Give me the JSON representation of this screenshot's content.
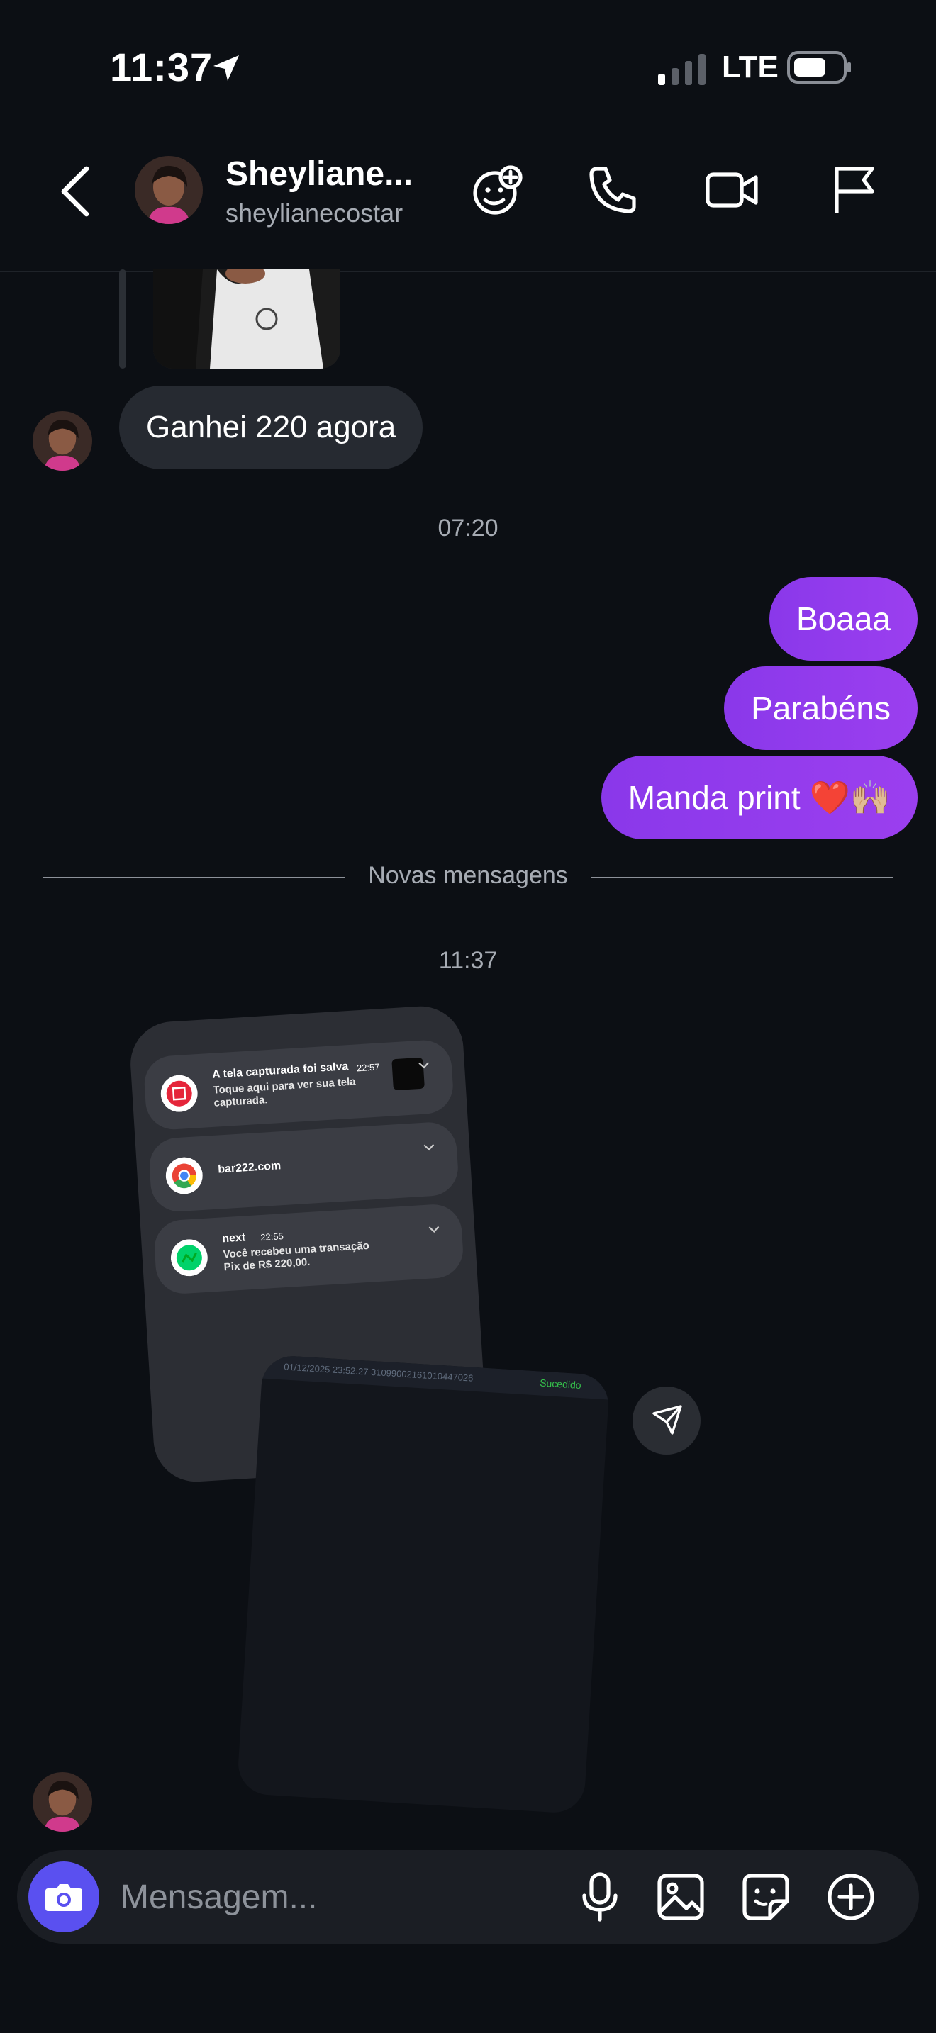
{
  "status_bar": {
    "time": "11:37",
    "network": "LTE"
  },
  "header": {
    "name": "Sheyliane...",
    "username": "sheylianecostar",
    "icons": [
      "back-icon",
      "add-emoji-icon",
      "phone-icon",
      "video-icon",
      "flag-icon"
    ]
  },
  "messages": {
    "incoming_1": "Ganhei 220 agora",
    "timestamp_1": "07:20",
    "outgoing": [
      "Boaaa",
      "Parabéns",
      "Manda print ❤️🙌🏼"
    ],
    "divider": "Novas mensagens",
    "timestamp_2": "11:37"
  },
  "shared_image": {
    "notifications": [
      {
        "title": "A tela capturada foi salva",
        "time": "22:57",
        "desc": "Toque aqui para ver sua tela capturada."
      },
      {
        "title": "bar222.com",
        "time": "",
        "desc": ""
      },
      {
        "title": "next",
        "time": "22:55",
        "desc": "Você recebeu uma transação Pix de R$ 220,00."
      }
    ],
    "receipt_line": "01/12/2025 23:52:27  31099002161010447026",
    "receipt_status": "Sucedido"
  },
  "composer": {
    "placeholder": "Mensagem...",
    "icons": [
      "camera-icon",
      "microphone-icon",
      "gallery-icon",
      "sticker-icon",
      "plus-icon"
    ]
  },
  "colors": {
    "background": "#0c0f14",
    "outgoing_bubble": "#9b3fef",
    "incoming_bubble": "#262a31",
    "camera_button": "#5a50f0"
  }
}
